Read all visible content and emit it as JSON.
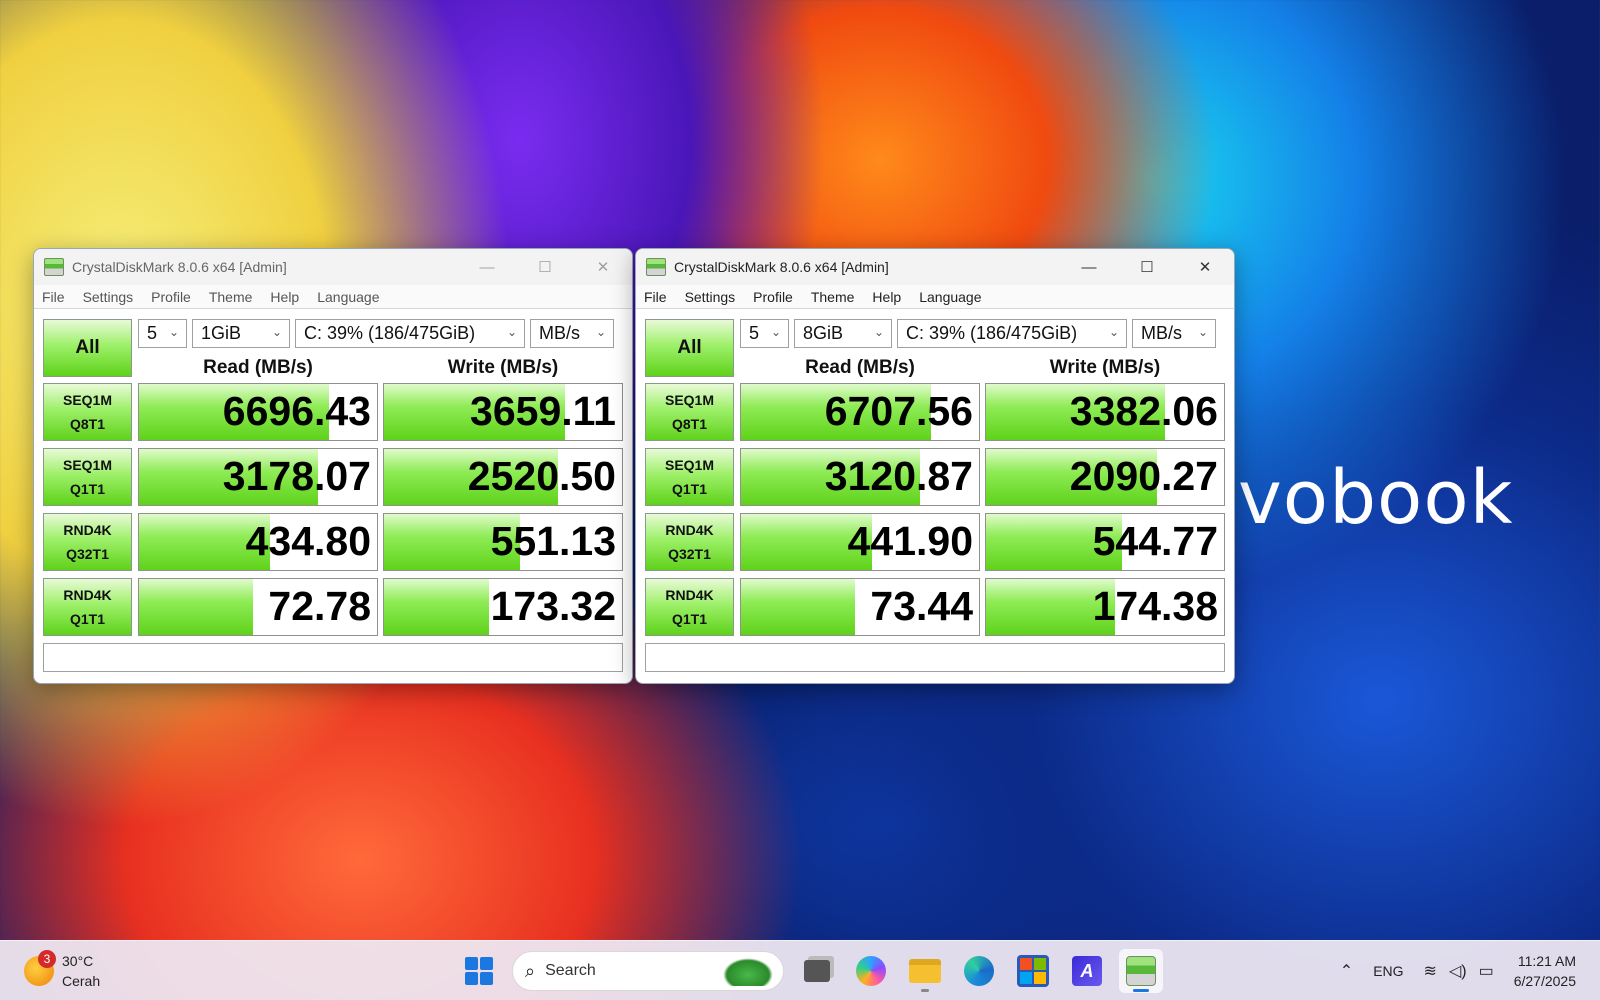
{
  "wallpaper": {
    "brand_text": "vobook"
  },
  "windows": [
    {
      "title": "CrystalDiskMark 8.0.6 x64 [Admin]",
      "menu": [
        "File",
        "Settings",
        "Profile",
        "Theme",
        "Help",
        "Language"
      ],
      "all_label": "All",
      "count": "5",
      "size": "1GiB",
      "drive": "C: 39% (186/475GiB)",
      "unit": "MB/s",
      "read_header": "Read (MB/s)",
      "write_header": "Write (MB/s)",
      "rows": [
        {
          "l1": "SEQ1M",
          "l2": "Q8T1",
          "read": "6696.43",
          "write": "3659.11",
          "read_fill": 0.8,
          "write_fill": 0.76
        },
        {
          "l1": "SEQ1M",
          "l2": "Q1T1",
          "read": "3178.07",
          "write": "2520.50",
          "read_fill": 0.75,
          "write_fill": 0.73
        },
        {
          "l1": "RND4K",
          "l2": "Q32T1",
          "read": "434.80",
          "write": "551.13",
          "read_fill": 0.55,
          "write_fill": 0.57
        },
        {
          "l1": "RND4K",
          "l2": "Q1T1",
          "read": "72.78",
          "write": "173.32",
          "read_fill": 0.48,
          "write_fill": 0.44
        }
      ]
    },
    {
      "title": "CrystalDiskMark 8.0.6 x64 [Admin]",
      "menu": [
        "File",
        "Settings",
        "Profile",
        "Theme",
        "Help",
        "Language"
      ],
      "all_label": "All",
      "count": "5",
      "size": "8GiB",
      "drive": "C: 39% (186/475GiB)",
      "unit": "MB/s",
      "read_header": "Read (MB/s)",
      "write_header": "Write (MB/s)",
      "rows": [
        {
          "l1": "SEQ1M",
          "l2": "Q8T1",
          "read": "6707.56",
          "write": "3382.06",
          "read_fill": 0.8,
          "write_fill": 0.75
        },
        {
          "l1": "SEQ1M",
          "l2": "Q1T1",
          "read": "3120.87",
          "write": "2090.27",
          "read_fill": 0.75,
          "write_fill": 0.72
        },
        {
          "l1": "RND4K",
          "l2": "Q32T1",
          "read": "441.90",
          "write": "544.77",
          "read_fill": 0.55,
          "write_fill": 0.57
        },
        {
          "l1": "RND4K",
          "l2": "Q1T1",
          "read": "73.44",
          "write": "174.38",
          "read_fill": 0.48,
          "write_fill": 0.54
        }
      ]
    }
  ],
  "taskbar": {
    "weather_badge": "3",
    "weather_temp": "30°C",
    "weather_desc": "Cerah",
    "search_placeholder": "Search",
    "app_icon_letters": "A",
    "language": "ENG",
    "time": "11:21 AM",
    "date": "6/27/2025",
    "store_colors": [
      "#f25022",
      "#7fba00",
      "#00a4ef",
      "#ffb900"
    ]
  }
}
